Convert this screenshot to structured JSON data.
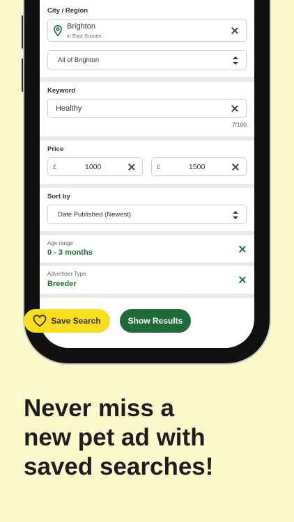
{
  "location": {
    "section_label": "City / Region",
    "city": "Brighton",
    "county": "in East Sussex",
    "area_select": "All of Brighton"
  },
  "keyword": {
    "section_label": "Keyword",
    "value": "Healthy",
    "counter": "7/100"
  },
  "price": {
    "section_label": "Price",
    "currency": "£",
    "min": "1000",
    "max": "1500"
  },
  "sort": {
    "section_label": "Sort by",
    "selected": "Date Published (Newest)"
  },
  "filters": {
    "age_label": "Age range",
    "age_value": "0 - 3 months",
    "advertiser_label": "Advertiser Type",
    "advertiser_value": "Breeder"
  },
  "actions": {
    "save_label": "Save Search",
    "show_label": "Show Results"
  },
  "tagline": [
    "Never miss a",
    "new pet ad with",
    "saved searches!"
  ],
  "colors": {
    "background": "#FDF8CB",
    "brand_green": "#1F6B3A",
    "brand_yellow": "#F9DD1E"
  }
}
